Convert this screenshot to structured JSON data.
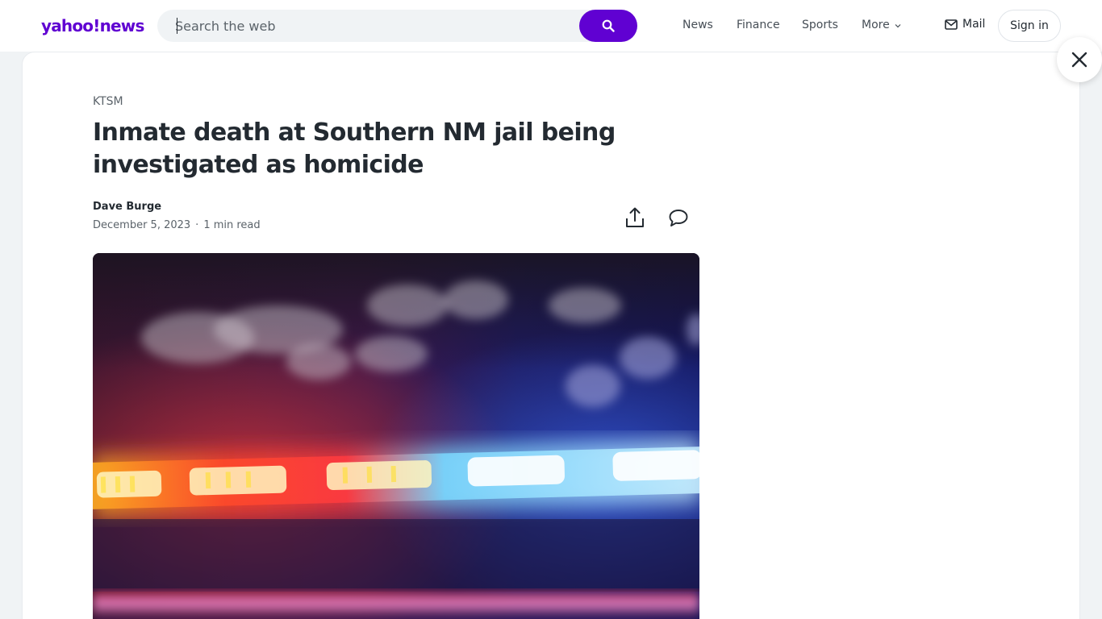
{
  "header": {
    "logo_part1": "yahoo!",
    "logo_part2": "news",
    "search_placeholder": "Search the web",
    "nav": [
      "News",
      "Finance",
      "Sports",
      "More"
    ],
    "mail_label": "Mail",
    "signin_label": "Sign in"
  },
  "article": {
    "provider": "KTSM",
    "title": "Inmate death at Southern NM jail being investigated as homicide",
    "author": "Dave Burge",
    "date": "December 5, 2023",
    "read_time": "1 min read",
    "hero_image": "police-lights-photo"
  },
  "colors": {
    "brand": "#6001d2",
    "text": "#232a31",
    "muted": "#5b636a"
  }
}
